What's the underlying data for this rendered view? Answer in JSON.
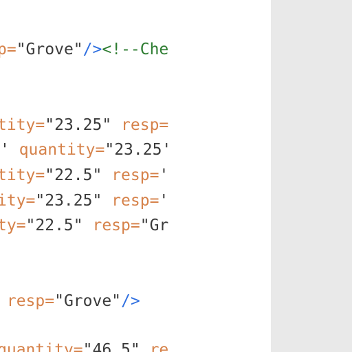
{
  "editor": {
    "lines": [
      {
        "id": "line-grove-comment",
        "segments": [
          {
            "kind": "attr",
            "text": "p="
          },
          {
            "kind": "val",
            "text": "\"Grove\""
          },
          {
            "kind": "punc",
            "text": "/>"
          },
          {
            "kind": "comment",
            "text": "<!--Che"
          }
        ]
      },
      {
        "id": "line-quantity-1",
        "segments": [
          {
            "kind": "attr",
            "text": "tity="
          },
          {
            "kind": "val",
            "text": "\"23.25\""
          },
          {
            "kind": "attr",
            "text": " resp="
          }
        ]
      },
      {
        "id": "line-quantity-2",
        "segments": [
          {
            "kind": "val",
            "text": "'"
          },
          {
            "kind": "attr",
            "text": " quantity="
          },
          {
            "kind": "val",
            "text": "\"23.25'"
          }
        ]
      },
      {
        "id": "line-quantity-3",
        "segments": [
          {
            "kind": "attr",
            "text": "tity="
          },
          {
            "kind": "val",
            "text": "\"22.5\""
          },
          {
            "kind": "attr",
            "text": " resp="
          },
          {
            "kind": "val",
            "text": "'"
          }
        ]
      },
      {
        "id": "line-quantity-4",
        "segments": [
          {
            "kind": "attr",
            "text": "ity="
          },
          {
            "kind": "val",
            "text": "\"23.25\""
          },
          {
            "kind": "attr",
            "text": " resp="
          },
          {
            "kind": "val",
            "text": "'"
          }
        ]
      },
      {
        "id": "line-quantity-5",
        "segments": [
          {
            "kind": "attr",
            "text": "ty="
          },
          {
            "kind": "val",
            "text": "\"22.5\""
          },
          {
            "kind": "attr",
            "text": " resp="
          },
          {
            "kind": "val",
            "text": "\"Gr"
          }
        ]
      },
      {
        "id": "line-resp-grove",
        "segments": [
          {
            "kind": "attr",
            "text": " resp="
          },
          {
            "kind": "val",
            "text": "\"Grove\""
          },
          {
            "kind": "punc",
            "text": "/>"
          }
        ]
      },
      {
        "id": "line-quantity-6",
        "segments": [
          {
            "kind": "attr",
            "text": "quantity="
          },
          {
            "kind": "val",
            "text": "\"46.5\""
          },
          {
            "kind": "attr",
            "text": " re"
          }
        ]
      }
    ]
  },
  "colors": {
    "attribute": "#d6824a",
    "value": "#3a3a3a",
    "tag_punctuation": "#2f6fe0",
    "comment": "#2e7d32",
    "side_pane_background": "#e9e9e9"
  }
}
